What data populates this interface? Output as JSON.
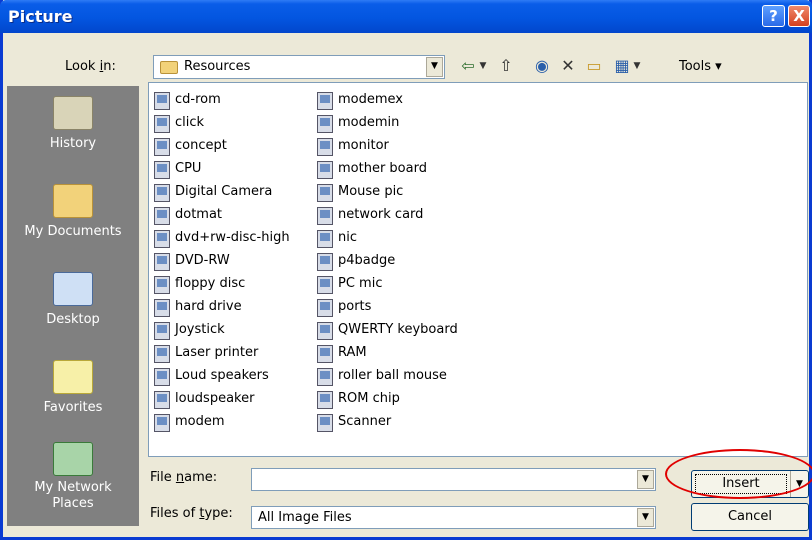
{
  "window": {
    "title": "Picture",
    "help_label": "?",
    "close_label": "X"
  },
  "lookin": {
    "label_pre": "Look ",
    "label_key": "i",
    "label_post": "n:",
    "value": "Resources",
    "tools_label": "Tools"
  },
  "places": [
    {
      "label": "History"
    },
    {
      "label": "My Documents"
    },
    {
      "label": "Desktop"
    },
    {
      "label": "Favorites"
    },
    {
      "label": "My Network Places"
    }
  ],
  "files_col1": [
    "cd-rom",
    "click",
    "concept",
    "CPU",
    "Digital Camera",
    "dotmat",
    "dvd+rw-disc-high",
    "DVD-RW",
    "floppy disc",
    "hard drive",
    "Joystick",
    "Laser printer",
    "Loud speakers",
    "loudspeaker",
    "modem"
  ],
  "files_col2": [
    "modemex",
    "modemin",
    "monitor",
    "mother board",
    "Mouse pic",
    "network card",
    "nic",
    "p4badge",
    "PC mic",
    "ports",
    "QWERTY keyboard",
    "RAM",
    "roller ball mouse",
    "ROM chip",
    "Scanner"
  ],
  "filename": {
    "label_pre": "File ",
    "label_key": "n",
    "label_post": "ame:",
    "value": ""
  },
  "filetype": {
    "label_pre": "Files of ",
    "label_key": "t",
    "label_post": "ype:",
    "value": "All Image Files"
  },
  "buttons": {
    "insert": "Insert",
    "cancel": "Cancel"
  },
  "colors": {
    "titlebar": "#0356e0",
    "highlight": "#e00000",
    "places_bg": "#808080"
  }
}
